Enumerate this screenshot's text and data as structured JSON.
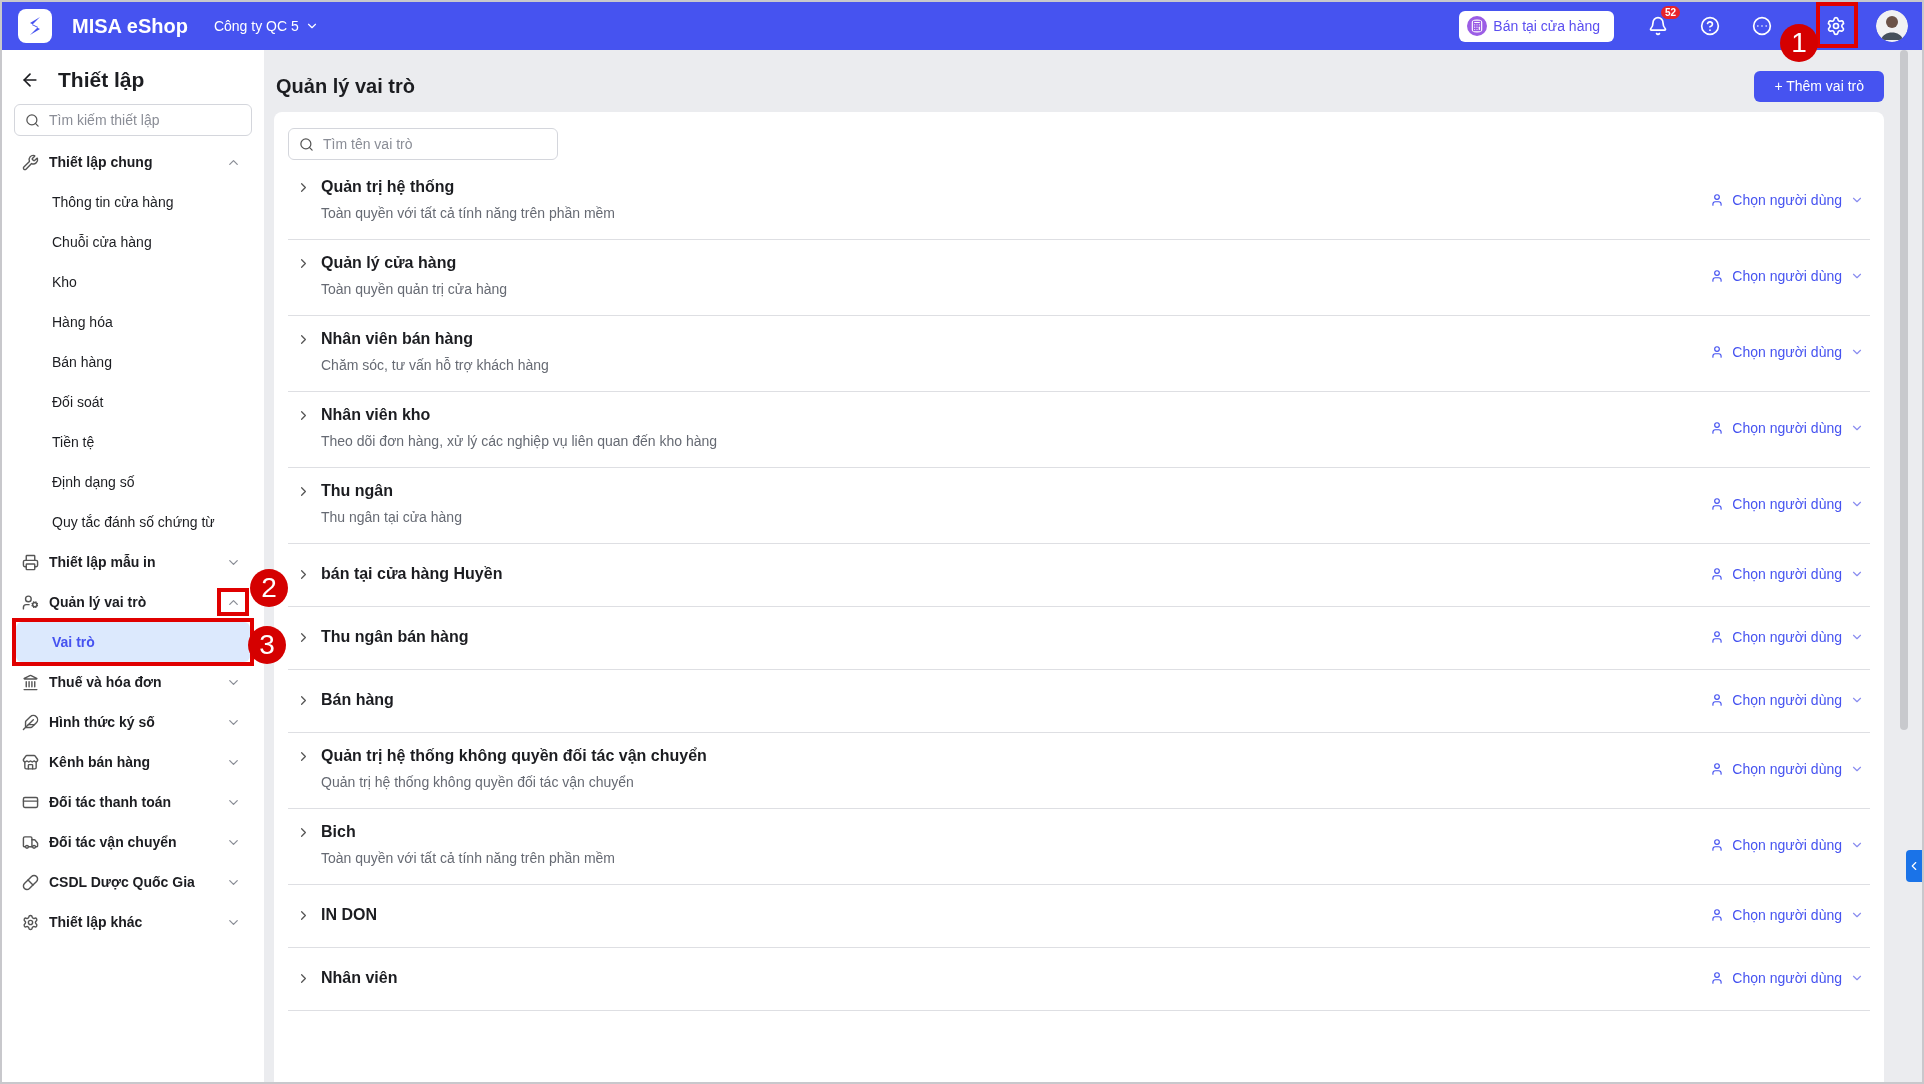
{
  "header": {
    "brand": "MISA eShop",
    "company": "Công ty QC 5",
    "store_button": "Bán tại cửa hàng",
    "notification_count": "52",
    "settings_callout": "1"
  },
  "sidebar": {
    "title": "Thiết lập",
    "search": {
      "placeholder": "Tìm kiếm thiết lập"
    },
    "groups": [
      {
        "label": "Thiết lập chung",
        "expanded": true,
        "items": [
          {
            "label": "Thông tin cửa hàng",
            "selected": false
          },
          {
            "label": "Chuỗi cửa hàng",
            "selected": false
          },
          {
            "label": "Kho",
            "selected": false
          },
          {
            "label": "Hàng hóa",
            "selected": false
          },
          {
            "label": "Bán hàng",
            "selected": false
          },
          {
            "label": "Đối soát",
            "selected": false
          },
          {
            "label": "Tiền tệ",
            "selected": false
          },
          {
            "label": "Định dạng số",
            "selected": false
          },
          {
            "label": "Quy tắc đánh số chứng từ",
            "selected": false
          }
        ]
      },
      {
        "label": "Thiết lập mẫu in",
        "expanded": false
      },
      {
        "label": "Quản lý vai trò",
        "expanded": true,
        "callout": "2",
        "items": [
          {
            "label": "Vai trò",
            "selected": true,
            "callout": "3"
          }
        ]
      },
      {
        "label": "Thuế và hóa đơn",
        "expanded": false
      },
      {
        "label": "Hình thức ký số",
        "expanded": false
      },
      {
        "label": "Kênh bán hàng",
        "expanded": false
      },
      {
        "label": "Đối tác thanh toán",
        "expanded": false
      },
      {
        "label": "Đối tác vận chuyển",
        "expanded": false
      },
      {
        "label": "CSDL Dược Quốc Gia",
        "expanded": false
      },
      {
        "label": "Thiết lập khác",
        "expanded": false
      }
    ]
  },
  "main": {
    "title": "Quản lý vai trò",
    "add_button": "+ Thêm vai trò",
    "search": {
      "placeholder": "Tìm tên vai trò"
    },
    "roles": [
      {
        "name": "Quản trị hệ thống",
        "description": "Toàn quyền với tất cả tính năng trên phần mềm",
        "action": "Chọn người dùng"
      },
      {
        "name": "Quản lý cửa hàng",
        "description": "Toàn quyền quản trị cửa hàng",
        "action": "Chọn người dùng"
      },
      {
        "name": "Nhân viên bán hàng",
        "description": "Chăm sóc, tư vấn hỗ trợ khách hàng",
        "action": "Chọn người dùng"
      },
      {
        "name": "Nhân viên kho",
        "description": "Theo dõi đơn hàng, xử lý các nghiệp vụ liên quan đến kho hàng",
        "action": "Chọn người dùng"
      },
      {
        "name": "Thu ngân",
        "description": "Thu ngân tại cửa hàng",
        "action": "Chọn người dùng"
      },
      {
        "name": "bán tại cửa hàng Huyền",
        "action": "Chọn người dùng"
      },
      {
        "name": "Thu ngân bán hàng",
        "action": "Chọn người dùng"
      },
      {
        "name": "Bán hàng",
        "action": "Chọn người dùng"
      },
      {
        "name": "Quản trị hệ thống không quyền đối tác vận chuyển",
        "description": "Quản trị hệ thống không quyền đối tác vận chuyển",
        "action": "Chọn người dùng"
      },
      {
        "name": "Bich",
        "description": "Toàn quyền với tất cả tính năng trên phần mềm",
        "action": "Chọn người dùng"
      },
      {
        "name": "IN DON",
        "action": "Chọn người dùng"
      },
      {
        "name": "Nhân viên",
        "action": "Chọn người dùng"
      }
    ]
  }
}
